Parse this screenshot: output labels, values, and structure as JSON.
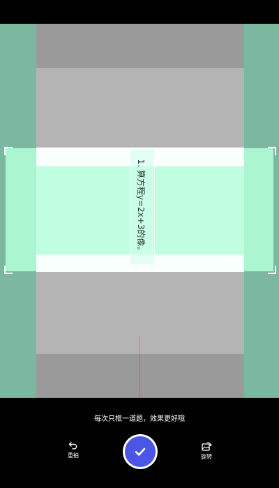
{
  "camera": {
    "question_text": "1. 算方程y=2x+3的像。"
  },
  "bottom_bar": {
    "hint": "每次只框一道题，效果更好哦",
    "retake_label": "重拍",
    "rotate_label": "旋转",
    "confirm_icon": "check-icon",
    "accent_color": "#4b55e6"
  }
}
